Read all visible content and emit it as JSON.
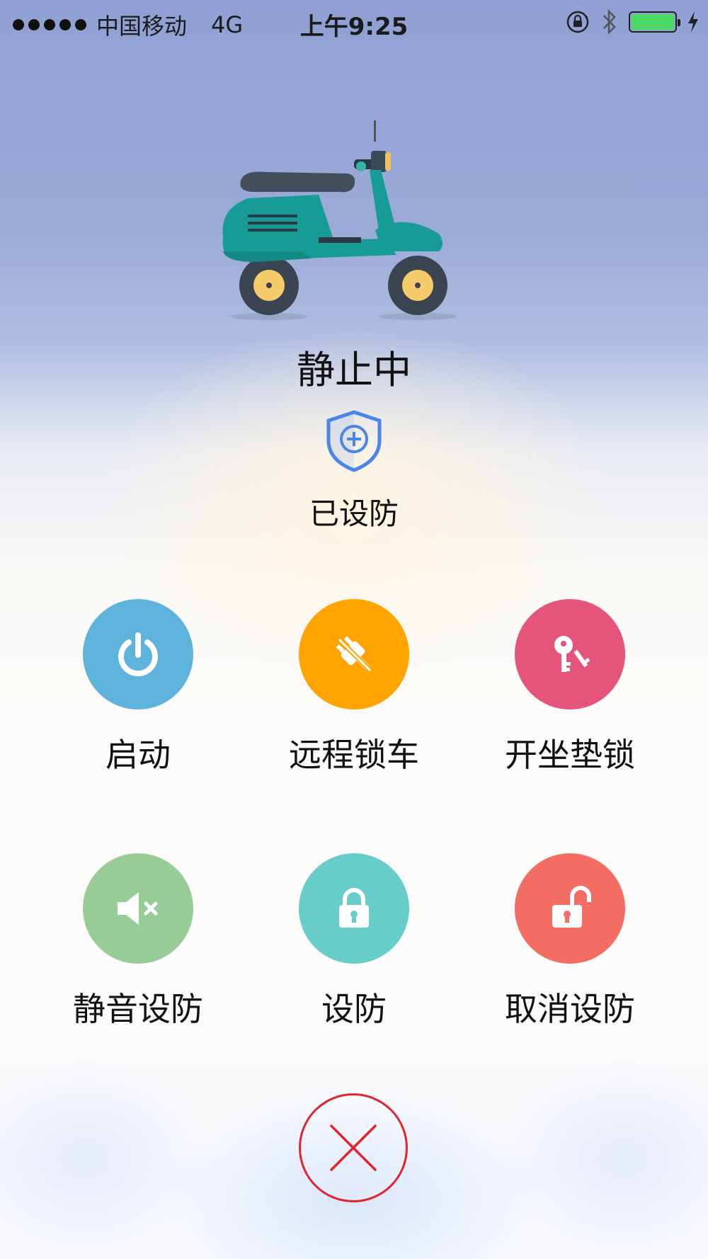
{
  "status_bar": {
    "carrier": "中国移动",
    "network": "4G",
    "time": "上午9:25",
    "battery_percent": 100
  },
  "vehicle": {
    "state": "静止中",
    "defense_status": "已设防"
  },
  "actions": [
    {
      "label": "启动",
      "icon": "power-icon",
      "color": "#5db3dc"
    },
    {
      "label": "远程锁车",
      "icon": "unplug-icon",
      "color": "#ffa400"
    },
    {
      "label": "开坐垫锁",
      "icon": "keys-icon",
      "color": "#e5547a"
    },
    {
      "label": "静音设防",
      "icon": "mute-icon",
      "color": "#98cc97"
    },
    {
      "label": "设防",
      "icon": "lock-icon",
      "color": "#67cdc9"
    },
    {
      "label": "取消设防",
      "icon": "unlock-icon",
      "color": "#f36d63"
    }
  ],
  "close_button": {
    "icon": "close-icon",
    "color": "#e0252e"
  },
  "colors": {
    "scooter_body": "#169c94",
    "shield": "#4a86e8"
  }
}
